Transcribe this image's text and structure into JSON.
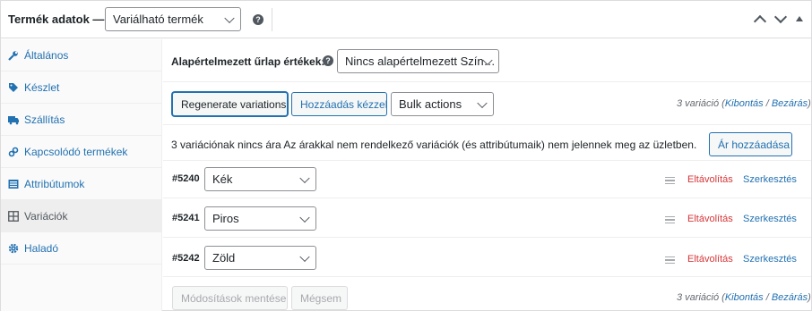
{
  "header": {
    "title": "Termék adatok —",
    "product_type": "Variálható termék"
  },
  "sidebar": {
    "items": [
      {
        "label": "Általános",
        "icon": "wrench-icon"
      },
      {
        "label": "Készlet",
        "icon": "tag-icon"
      },
      {
        "label": "Szállítás",
        "icon": "truck-icon"
      },
      {
        "label": "Kapcsolódó termékek",
        "icon": "link-icon"
      },
      {
        "label": "Attribútumok",
        "icon": "list-icon"
      },
      {
        "label": "Variációk",
        "icon": "grid-icon"
      },
      {
        "label": "Haladó",
        "icon": "gear-icon"
      }
    ],
    "active": "Variációk"
  },
  "defaults": {
    "label": "Alapértelmezett űrlap értékek:",
    "select_value": "Nincs alapértelmezett Szín…"
  },
  "toolbar": {
    "regenerate_label": "Regenerate variations",
    "add_manual_label": "Hozzáadás kézzel",
    "bulk_value": "Bulk actions",
    "count_text": "3 variáció",
    "expand_label": "Kibontás",
    "separator": "/",
    "close_label": "Bezárás"
  },
  "notice": {
    "text": "3 variációnak nincs ára Az árakkal nem rendelkező variációk (és attribútumaik) nem jelennek meg az üzletben.",
    "add_price_label": "Ár hozzáadása"
  },
  "variations": [
    {
      "id": "#5240",
      "value": "Kék",
      "remove_label": "Eltávolítás",
      "edit_label": "Szerkesztés"
    },
    {
      "id": "#5241",
      "value": "Piros",
      "remove_label": "Eltávolítás",
      "edit_label": "Szerkesztés"
    },
    {
      "id": "#5242",
      "value": "Zöld",
      "remove_label": "Eltávolítás",
      "edit_label": "Szerkesztés"
    }
  ],
  "footer": {
    "save_label": "Módosítások mentése",
    "cancel_label": "Mégsem",
    "count_text": "3 variáció",
    "expand_label": "Kibontás",
    "separator": "/",
    "close_label": "Bezárás"
  },
  "colors": {
    "link": "#2271b1",
    "danger": "#d63638",
    "border": "#dcdcde"
  }
}
